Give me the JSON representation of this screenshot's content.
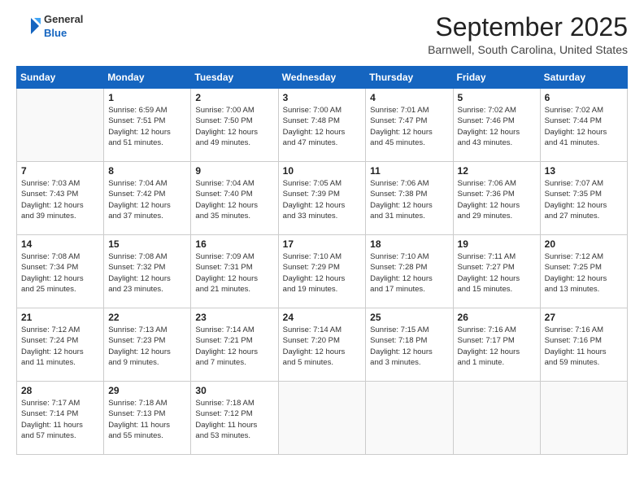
{
  "header": {
    "logo_line1": "General",
    "logo_line2": "Blue",
    "month_title": "September 2025",
    "location": "Barnwell, South Carolina, United States"
  },
  "days_of_week": [
    "Sunday",
    "Monday",
    "Tuesday",
    "Wednesday",
    "Thursday",
    "Friday",
    "Saturday"
  ],
  "weeks": [
    [
      {
        "day": "",
        "info": ""
      },
      {
        "day": "1",
        "info": "Sunrise: 6:59 AM\nSunset: 7:51 PM\nDaylight: 12 hours\nand 51 minutes."
      },
      {
        "day": "2",
        "info": "Sunrise: 7:00 AM\nSunset: 7:50 PM\nDaylight: 12 hours\nand 49 minutes."
      },
      {
        "day": "3",
        "info": "Sunrise: 7:00 AM\nSunset: 7:48 PM\nDaylight: 12 hours\nand 47 minutes."
      },
      {
        "day": "4",
        "info": "Sunrise: 7:01 AM\nSunset: 7:47 PM\nDaylight: 12 hours\nand 45 minutes."
      },
      {
        "day": "5",
        "info": "Sunrise: 7:02 AM\nSunset: 7:46 PM\nDaylight: 12 hours\nand 43 minutes."
      },
      {
        "day": "6",
        "info": "Sunrise: 7:02 AM\nSunset: 7:44 PM\nDaylight: 12 hours\nand 41 minutes."
      }
    ],
    [
      {
        "day": "7",
        "info": "Sunrise: 7:03 AM\nSunset: 7:43 PM\nDaylight: 12 hours\nand 39 minutes."
      },
      {
        "day": "8",
        "info": "Sunrise: 7:04 AM\nSunset: 7:42 PM\nDaylight: 12 hours\nand 37 minutes."
      },
      {
        "day": "9",
        "info": "Sunrise: 7:04 AM\nSunset: 7:40 PM\nDaylight: 12 hours\nand 35 minutes."
      },
      {
        "day": "10",
        "info": "Sunrise: 7:05 AM\nSunset: 7:39 PM\nDaylight: 12 hours\nand 33 minutes."
      },
      {
        "day": "11",
        "info": "Sunrise: 7:06 AM\nSunset: 7:38 PM\nDaylight: 12 hours\nand 31 minutes."
      },
      {
        "day": "12",
        "info": "Sunrise: 7:06 AM\nSunset: 7:36 PM\nDaylight: 12 hours\nand 29 minutes."
      },
      {
        "day": "13",
        "info": "Sunrise: 7:07 AM\nSunset: 7:35 PM\nDaylight: 12 hours\nand 27 minutes."
      }
    ],
    [
      {
        "day": "14",
        "info": "Sunrise: 7:08 AM\nSunset: 7:34 PM\nDaylight: 12 hours\nand 25 minutes."
      },
      {
        "day": "15",
        "info": "Sunrise: 7:08 AM\nSunset: 7:32 PM\nDaylight: 12 hours\nand 23 minutes."
      },
      {
        "day": "16",
        "info": "Sunrise: 7:09 AM\nSunset: 7:31 PM\nDaylight: 12 hours\nand 21 minutes."
      },
      {
        "day": "17",
        "info": "Sunrise: 7:10 AM\nSunset: 7:29 PM\nDaylight: 12 hours\nand 19 minutes."
      },
      {
        "day": "18",
        "info": "Sunrise: 7:10 AM\nSunset: 7:28 PM\nDaylight: 12 hours\nand 17 minutes."
      },
      {
        "day": "19",
        "info": "Sunrise: 7:11 AM\nSunset: 7:27 PM\nDaylight: 12 hours\nand 15 minutes."
      },
      {
        "day": "20",
        "info": "Sunrise: 7:12 AM\nSunset: 7:25 PM\nDaylight: 12 hours\nand 13 minutes."
      }
    ],
    [
      {
        "day": "21",
        "info": "Sunrise: 7:12 AM\nSunset: 7:24 PM\nDaylight: 12 hours\nand 11 minutes."
      },
      {
        "day": "22",
        "info": "Sunrise: 7:13 AM\nSunset: 7:23 PM\nDaylight: 12 hours\nand 9 minutes."
      },
      {
        "day": "23",
        "info": "Sunrise: 7:14 AM\nSunset: 7:21 PM\nDaylight: 12 hours\nand 7 minutes."
      },
      {
        "day": "24",
        "info": "Sunrise: 7:14 AM\nSunset: 7:20 PM\nDaylight: 12 hours\nand 5 minutes."
      },
      {
        "day": "25",
        "info": "Sunrise: 7:15 AM\nSunset: 7:18 PM\nDaylight: 12 hours\nand 3 minutes."
      },
      {
        "day": "26",
        "info": "Sunrise: 7:16 AM\nSunset: 7:17 PM\nDaylight: 12 hours\nand 1 minute."
      },
      {
        "day": "27",
        "info": "Sunrise: 7:16 AM\nSunset: 7:16 PM\nDaylight: 11 hours\nand 59 minutes."
      }
    ],
    [
      {
        "day": "28",
        "info": "Sunrise: 7:17 AM\nSunset: 7:14 PM\nDaylight: 11 hours\nand 57 minutes."
      },
      {
        "day": "29",
        "info": "Sunrise: 7:18 AM\nSunset: 7:13 PM\nDaylight: 11 hours\nand 55 minutes."
      },
      {
        "day": "30",
        "info": "Sunrise: 7:18 AM\nSunset: 7:12 PM\nDaylight: 11 hours\nand 53 minutes."
      },
      {
        "day": "",
        "info": ""
      },
      {
        "day": "",
        "info": ""
      },
      {
        "day": "",
        "info": ""
      },
      {
        "day": "",
        "info": ""
      }
    ]
  ]
}
